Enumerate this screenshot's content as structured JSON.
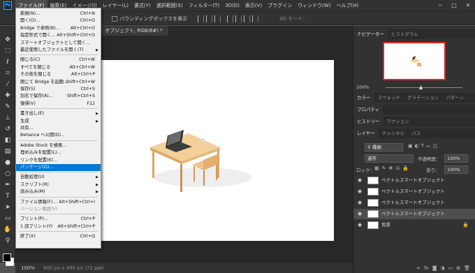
{
  "app": {
    "logo": "Ps"
  },
  "menubar": {
    "items": [
      "ファイル(F)",
      "編集(E)",
      "イメージ(I)",
      "レイヤー(L)",
      "書式(Y)",
      "選択範囲(S)",
      "フィルター(T)",
      "3D(D)",
      "表示(V)",
      "プラグイン",
      "ウィンドウ(W)",
      "ヘルプ(H)"
    ],
    "win": {
      "min": "─",
      "max": "□",
      "close": "✕"
    }
  },
  "options": {
    "bbox_label": "バウンディングボックスを表示",
    "mode3d": "3D モード："
  },
  "document": {
    "tab_label": "オブジェクト, RGB/8#) *"
  },
  "status": {
    "zoom": "100%",
    "size": "800 px x 480 px (72 ppi)"
  },
  "file_menu": [
    {
      "label": "新規(N)...",
      "shortcut": "Ctrl+N"
    },
    {
      "label": "開く(O)...",
      "shortcut": "Ctrl+O"
    },
    {
      "label": "Bridge で参照(B)...",
      "shortcut": "Alt+Ctrl+O"
    },
    {
      "label": "指定形式で開く...",
      "shortcut": "Alt+Shift+Ctrl+O"
    },
    {
      "label": "スマートオブジェクトとして開く..."
    },
    {
      "label": "最近使用したファイルを開く(T)",
      "submenu": true
    },
    {
      "sep": true
    },
    {
      "label": "閉じる(C)",
      "shortcut": "Ctrl+W"
    },
    {
      "label": "すべてを閉じる",
      "shortcut": "Alt+Ctrl+W"
    },
    {
      "label": "その他を閉じる",
      "shortcut": "Alt+Ctrl+P"
    },
    {
      "label": "閉じて Bridge を起動...",
      "shortcut": "Shift+Ctrl+W"
    },
    {
      "label": "保存(S)",
      "shortcut": "Ctrl+S"
    },
    {
      "label": "別名で保存(A)...",
      "shortcut": "Shift+Ctrl+S"
    },
    {
      "label": "復帰(V)",
      "shortcut": "F12"
    },
    {
      "sep": true
    },
    {
      "label": "書き出し(E)",
      "submenu": true
    },
    {
      "label": "生成",
      "submenu": true
    },
    {
      "label": "共有..."
    },
    {
      "label": "Behance へ公開(D)..."
    },
    {
      "sep": true
    },
    {
      "label": "Adobe Stock を検索..."
    },
    {
      "label": "埋め込みを配置(L)..."
    },
    {
      "label": "リンクを配置(K)..."
    },
    {
      "label": "パッケージ(G)...",
      "highlight": true
    },
    {
      "sep": true
    },
    {
      "label": "自動処理(U)",
      "submenu": true
    },
    {
      "label": "スクリプト(R)",
      "submenu": true
    },
    {
      "label": "読み込み(M)",
      "submenu": true
    },
    {
      "sep": true
    },
    {
      "label": "ファイル情報(F)...",
      "shortcut": "Alt+Shift+Ctrl+I"
    },
    {
      "label": "バージョン履歴(V)",
      "disabled": true
    },
    {
      "sep": true
    },
    {
      "label": "プリント(P)...",
      "shortcut": "Ctrl+P"
    },
    {
      "label": "1 部プリント(Y)",
      "shortcut": "Alt+Shift+Ctrl+P"
    },
    {
      "sep": true
    },
    {
      "label": "終了(X)",
      "shortcut": "Ctrl+Q"
    }
  ],
  "navigator": {
    "tabs": [
      "ナビゲーター",
      "ヒストグラム"
    ],
    "zoom": "100%"
  },
  "color_panel": {
    "tabs": [
      "カラー",
      "スウォッチ",
      "グラデーション",
      "パターン"
    ]
  },
  "properties": {
    "tabs": [
      "プロパティ"
    ]
  },
  "history": {
    "tabs": [
      "ヒストリー",
      "アクション"
    ]
  },
  "layers": {
    "tabs": [
      "レイヤー",
      "チャンネル",
      "パス"
    ],
    "filter_label": "種類",
    "blend_mode": "通常",
    "opacity_label": "不透明度：",
    "opacity": "100%",
    "lock_label": "ロック：",
    "fill_label": "塗り：",
    "fill": "100%",
    "items": [
      {
        "name": "ベクトルスマートオブジェクト",
        "selected": false
      },
      {
        "name": "ベクトルスマートオブジェクト",
        "selected": false
      },
      {
        "name": "ベクトルスマートオブジェクト",
        "selected": false
      },
      {
        "name": "ベクトルスマートオブジェクト",
        "selected": true
      },
      {
        "name": "背景",
        "selected": false
      }
    ],
    "footer_icons": [
      "link-icon",
      "fx-icon",
      "mask-icon",
      "adjustment-icon",
      "group-icon",
      "new-layer-icon",
      "trash-icon"
    ]
  }
}
